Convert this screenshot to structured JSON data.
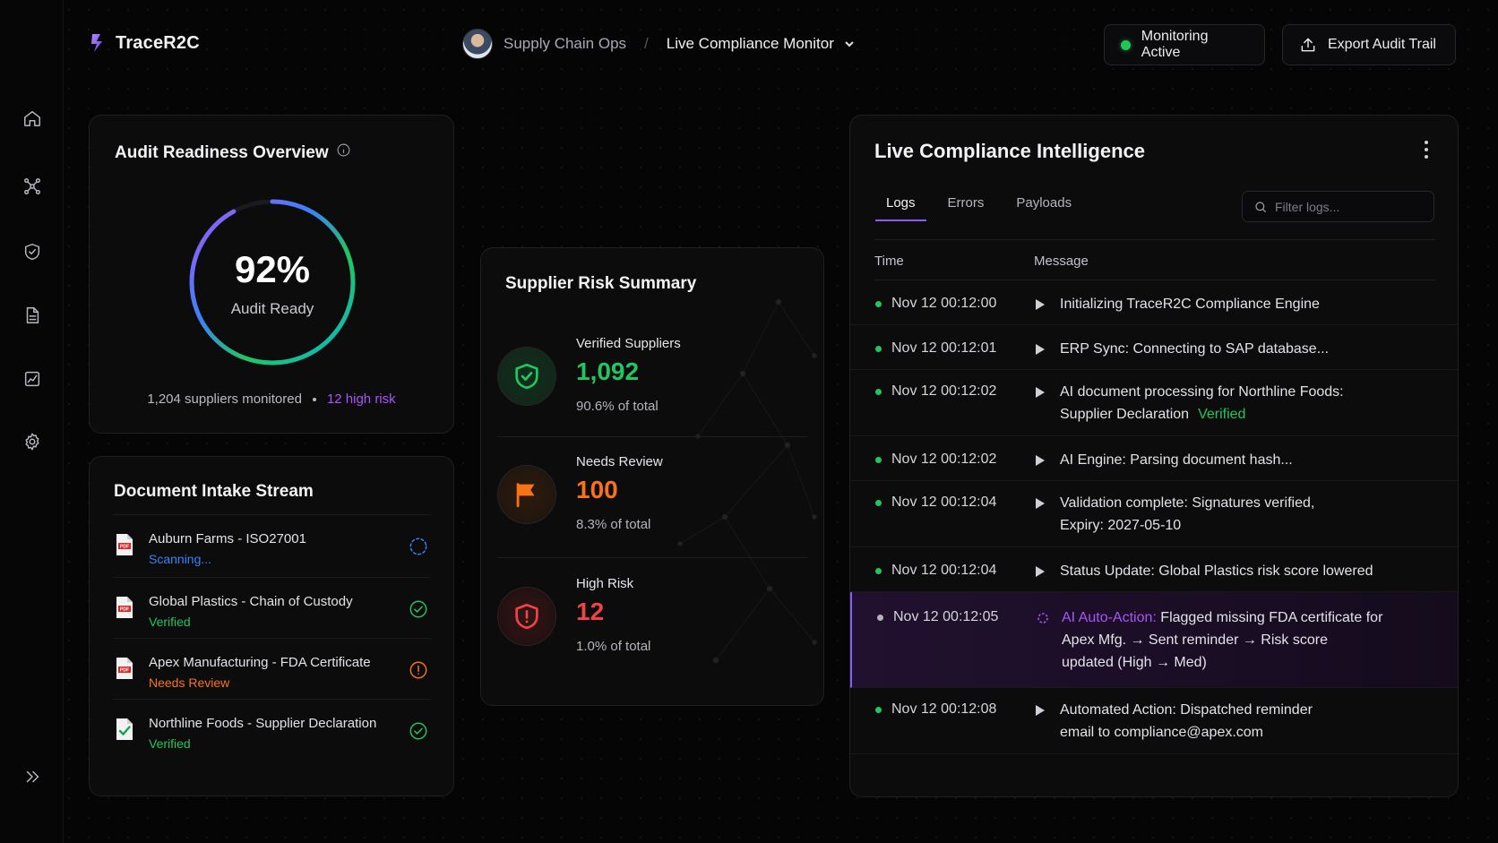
{
  "brand": {
    "name": "TraceR2C"
  },
  "breadcrumb": {
    "workspace": "Supply Chain Ops",
    "separator": "/",
    "page": "Live Compliance Monitor"
  },
  "header": {
    "monitoring_label": "Monitoring Active",
    "export_label": "Export Audit Trail"
  },
  "sidebar": {
    "items": [
      {
        "icon": "home-icon"
      },
      {
        "icon": "network-icon"
      },
      {
        "icon": "shield-check-icon"
      },
      {
        "icon": "document-icon"
      },
      {
        "icon": "analytics-icon"
      },
      {
        "icon": "gear-icon"
      }
    ],
    "expand_icon": "chevrons-right-icon"
  },
  "audit": {
    "title": "Audit Readiness Overview",
    "value_text": "92%",
    "value_fraction": 0.92,
    "label": "Audit Ready",
    "suppliers_monitored": "1,204 suppliers monitored",
    "high_risk": "12 high risk"
  },
  "intake": {
    "title": "Document Intake Stream",
    "items": [
      {
        "name": "Auburn Farms - ISO27001",
        "status": "Scanning...",
        "state": "scanning",
        "color": "#3b82f6",
        "file": "PDF"
      },
      {
        "name": "Global Plastics - Chain of Custody",
        "status": "Verified",
        "state": "verified",
        "color": "#22c55e",
        "file": "PDF"
      },
      {
        "name": "Apex Manufacturing - FDA Certificate",
        "status": "Needs Review",
        "state": "review",
        "color": "#f97316",
        "file": "PDF"
      },
      {
        "name": "Northline Foods - Supplier Declaration",
        "status": "Verified",
        "state": "verified",
        "color": "#22c55e",
        "file": ""
      }
    ]
  },
  "risk": {
    "title": "Supplier Risk Summary",
    "rows": [
      {
        "label": "Verified Suppliers",
        "value": "1,092",
        "pct": "90.6% of total",
        "color": "#22c55e",
        "icon": "shield-check-icon"
      },
      {
        "label": "Needs Review",
        "value": "100",
        "pct": "8.3% of total",
        "color": "#f97316",
        "icon": "flag-icon"
      },
      {
        "label": "High Risk",
        "value": "12",
        "pct": "1.0% of total",
        "color": "#ef4444",
        "icon": "shield-alert-icon"
      }
    ]
  },
  "live": {
    "title": "Live Compliance Intelligence",
    "tabs": [
      "Logs",
      "Errors",
      "Payloads"
    ],
    "filter_placeholder": "Filter logs...",
    "columns": {
      "time": "Time",
      "message": "Message"
    },
    "logs": [
      {
        "time": "Nov 12 00:12:00",
        "lines": [
          "Initializing TraceR2C Compliance Engine"
        ]
      },
      {
        "time": "Nov 12 00:12:01",
        "lines": [
          "ERP Sync: Connecting to SAP database..."
        ]
      },
      {
        "time": "Nov 12 00:12:02",
        "lines": [
          "AI document processing for Northline Foods:",
          "Supplier Declaration"
        ],
        "badge": "Verified"
      },
      {
        "time": "Nov 12 00:12:02",
        "lines": [
          "AI Engine: Parsing document hash..."
        ]
      },
      {
        "time": "Nov 12 00:12:04",
        "lines": [
          "Validation complete: Signatures verified,",
          "Expiry: 2027-05-10"
        ]
      },
      {
        "time": "Nov 12 00:12:04",
        "lines": [
          "Status Update: Global Plastics risk score lowered"
        ]
      },
      {
        "time": "Nov 12 00:12:05",
        "prefix": "AI Auto-Action:",
        "lines": [
          "Flagged missing FDA certificate for",
          "Apex Mfg. → Sent reminder → Risk score",
          "updated (High → Med)"
        ],
        "highlight": true
      },
      {
        "time": "Nov 12 00:12:08",
        "lines": [
          "Automated Action: Dispatched reminder",
          "email to compliance@apex.com"
        ]
      }
    ]
  }
}
